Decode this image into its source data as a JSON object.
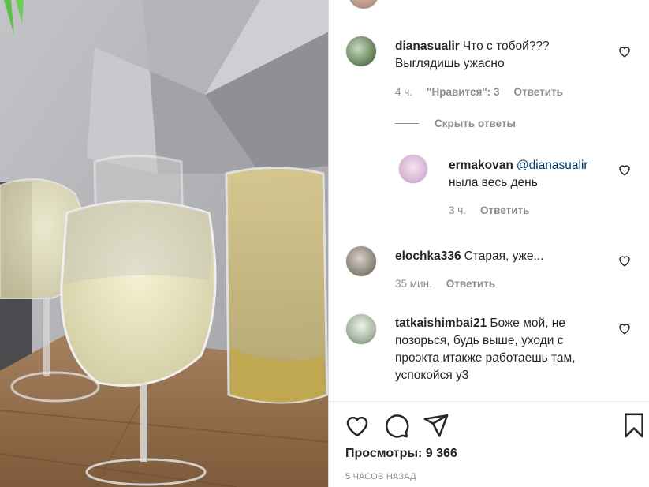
{
  "comments": [
    {
      "username": "dianasualir",
      "text": "Что с тобой???",
      "text_line2": "Выглядишь ужасно",
      "time": "4 ч.",
      "likes": "\"Нравится\": 3",
      "reply": "Ответить"
    },
    {
      "username": "elochka336",
      "text": "Старая, уже...",
      "time": "35 мин.",
      "reply": "Ответить"
    },
    {
      "username": "tatkaishimbai21",
      "text": "Боже мой, не",
      "text_line2": "позорься, будь выше, уходи с",
      "text_line3": "проэкта итакже работаешь там,",
      "text_line4": "успокойся у3"
    }
  ],
  "hide_replies": "Скрыть ответы",
  "reply": {
    "username": "ermakovan",
    "mention": "@dianasualir",
    "text": "ныла весь день",
    "time": "3 ч.",
    "reply": "Ответить"
  },
  "views": "Просмотры: 9 366",
  "posted": "5 ЧАСОВ НАЗАД",
  "icons": {
    "like": "heart-icon",
    "comment": "comment-icon",
    "share": "paper-plane-icon",
    "save": "bookmark-icon"
  },
  "colors": {
    "text": "#262626",
    "muted": "#8e8e8e",
    "mention": "#00376b"
  }
}
